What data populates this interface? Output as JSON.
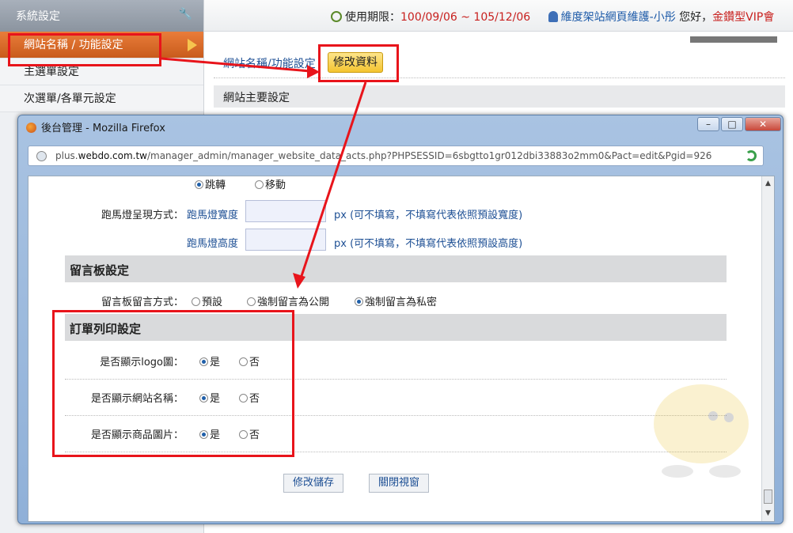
{
  "sidebar": {
    "title": "系統設定",
    "items": [
      {
        "label": "網站名稱 / 功能設定"
      },
      {
        "label": "主選單設定"
      },
      {
        "label": "次選單/各單元設定"
      }
    ]
  },
  "topbar": {
    "period_label": "使用期限：",
    "period_value": "100/09/06 ~ 105/12/06",
    "maintainer": "維度架站網頁維護-小彤",
    "greeting": "您好，",
    "plan": "金鑽型VIP會"
  },
  "main": {
    "breadcrumb": "網站名稱/功能設定",
    "edit_button": "修改資料",
    "section_title": "網站主要設定"
  },
  "firefox": {
    "title": "後台管理 - Mozilla Firefox",
    "url_prefix": "plus.",
    "url_host": "webdo.com.tw",
    "url_path": "/manager_admin/manager_website_data_acts.php?PHPSESSID=6sbgtto1gr012dbi33883o2mm0&Pact=edit&Pgid=926"
  },
  "form": {
    "top_options": [
      "跳轉",
      "移動"
    ],
    "marquee_label": "跑馬燈呈現方式：",
    "marquee_width": "跑馬燈寬度",
    "marquee_height": "跑馬燈高度",
    "width_hint": "px (可不填寫，不填寫代表依照預設寬度)",
    "height_hint": "px (可不填寫，不填寫代表依照預設高度)",
    "guestbook_section": "留言板設定",
    "guestbook_label": "留言板留言方式：",
    "guestbook_options": [
      "預設",
      "強制留言為公開",
      "強制留言為私密"
    ],
    "order_section": "訂單列印設定",
    "show_logo": "是否顯示logo圖：",
    "show_site_name": "是否顯示網站名稱：",
    "show_product_img": "是否顯示商品圖片：",
    "yes": "是",
    "no": "否",
    "save_button": "修改儲存",
    "close_button": "關閉視窗"
  },
  "colors": {
    "annotation": "#e8141b",
    "accent_orange": "#e97d3a"
  }
}
